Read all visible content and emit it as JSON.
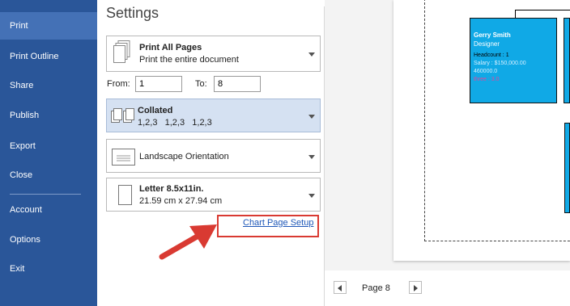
{
  "sidebar": {
    "items": [
      {
        "label": "Print"
      },
      {
        "label": "Print Outline"
      },
      {
        "label": "Share"
      },
      {
        "label": "Publish"
      },
      {
        "label": "Export"
      },
      {
        "label": "Close"
      },
      {
        "label": "Account"
      },
      {
        "label": "Options"
      },
      {
        "label": "Exit"
      }
    ]
  },
  "settings": {
    "title": "Settings",
    "print_pages": {
      "title": "Print All Pages",
      "subtitle": "Print the entire document"
    },
    "range": {
      "from_label": "From:",
      "from_value": "1",
      "to_label": "To:",
      "to_value": "8"
    },
    "collation": {
      "title": "Collated",
      "subtitle": "1,2,3   1,2,3   1,2,3"
    },
    "orientation": {
      "title": "Landscape Orientation"
    },
    "paper": {
      "title": "Letter 8.5x11in.",
      "subtitle": "21.59 cm x 27.94 cm"
    },
    "setup_link": "Chart Page Setup"
  },
  "preview": {
    "card": {
      "name": "Gerry Smith",
      "role": "Designer",
      "headcount": "Headcount : 1",
      "salary": "Salary : $150,000.00",
      "value": "460000.0",
      "extra": "three : 3.0"
    },
    "page_label": "Page 8"
  },
  "colors": {
    "sidebar": "#2a5699",
    "sidebar_active": "#4471b6",
    "card": "#10a9e6",
    "highlight": "#d93a32",
    "link": "#1f58b8"
  }
}
